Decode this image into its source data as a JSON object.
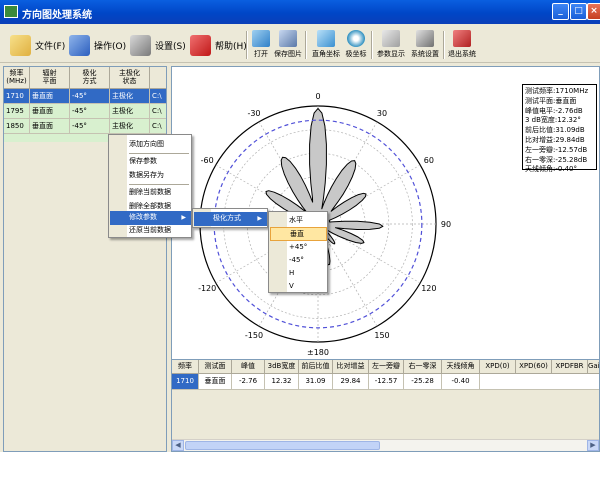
{
  "window": {
    "title": "方向图处理系统"
  },
  "menubar": [
    {
      "label": "文件(F)",
      "icon": "file-icon"
    },
    {
      "label": "操作(O)",
      "icon": "operate-icon"
    },
    {
      "label": "设置(S)",
      "icon": "settings-icon"
    },
    {
      "label": "帮助(H)",
      "icon": "help-icon"
    }
  ],
  "toolbar": [
    {
      "label": "打开",
      "icon": "open-icon"
    },
    {
      "label": "保存图片",
      "icon": "save-image-icon"
    },
    {
      "label": "直角坐标",
      "icon": "cartesian-icon"
    },
    {
      "label": "极坐标",
      "icon": "polar-icon"
    },
    {
      "label": "参数显示",
      "icon": "params-icon"
    },
    {
      "label": "系统设置",
      "icon": "system-settings-icon"
    },
    {
      "label": "退出系统",
      "icon": "exit-icon"
    }
  ],
  "left_grid": {
    "headers": [
      "频率\n(MHz)",
      "辐射\n平面",
      "极化\n方式",
      "主极化\n状态",
      ""
    ],
    "rows": [
      [
        "1710",
        "垂直面",
        "-45°",
        "主极化",
        "C:\\"
      ],
      [
        "1795",
        "垂直面",
        "-45°",
        "主极化",
        "C:\\"
      ],
      [
        "1850",
        "垂直面",
        "-45°",
        "主极化",
        "C:\\"
      ]
    ],
    "selected_row": 0
  },
  "context_menu": {
    "items": [
      "添加方向图",
      "保存参数",
      "数据另存为",
      "删除当前数据",
      "删除全部数据",
      "修改参数",
      "还原当前数据"
    ],
    "highlighted": "修改参数"
  },
  "submenu1": {
    "items": [
      "极化方式"
    ],
    "highlighted": "极化方式"
  },
  "submenu2": {
    "items": [
      "水平",
      "垂直",
      "+45°",
      "-45°",
      "H",
      "V"
    ],
    "highlighted": "垂直"
  },
  "polar": {
    "angle_labels": [
      {
        "deg": 0,
        "text": "0"
      },
      {
        "deg": 30,
        "text": "30"
      },
      {
        "deg": 60,
        "text": "60"
      },
      {
        "deg": 90,
        "text": "90"
      },
      {
        "deg": 120,
        "text": "120"
      },
      {
        "deg": 150,
        "text": "150"
      },
      {
        "deg": 180,
        "text": "±180"
      },
      {
        "deg": -150,
        "text": "-150"
      },
      {
        "deg": -120,
        "text": "-120"
      },
      {
        "deg": -90,
        "text": "-90"
      },
      {
        "deg": -60,
        "text": "-60"
      },
      {
        "deg": -30,
        "text": "-30"
      }
    ],
    "pattern_color": "#c8c8c8",
    "circle_color": "#5050d8"
  },
  "info": {
    "lines": [
      "测试频率:1710MHz",
      "测试平面:垂直面",
      "峰值电平:-2.76dB",
      "3 dB宽度:12.32°",
      "前后比值:31.09dB",
      "比对增益:29.84dB",
      "左一旁瓣:-12.57dB",
      "右一零深:-25.28dB",
      "天线倾角:-0.40°"
    ]
  },
  "bottom_grid": {
    "headers": [
      "频率",
      "测试面",
      "峰值",
      "3dB宽度",
      "前后比值",
      "比对增益",
      "左一旁瓣",
      "右一零深",
      "天线倾角",
      "XPD(0)",
      "XPD(60)",
      "XPDFBR",
      "Gai"
    ],
    "row": [
      "1710",
      "垂直面",
      "-2.76",
      "12.32",
      "31.09",
      "29.84",
      "-12.57",
      "-25.28",
      "-0.40",
      "",
      "",
      "",
      ""
    ]
  }
}
